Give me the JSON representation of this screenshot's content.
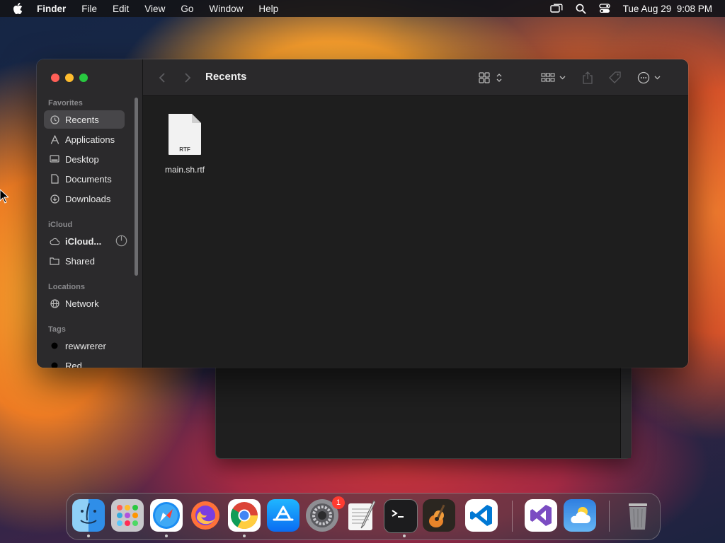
{
  "menubar": {
    "app_name": "Finder",
    "items": [
      "File",
      "Edit",
      "View",
      "Go",
      "Window",
      "Help"
    ],
    "clock": "Tue Aug 29  9:08 PM",
    "status_icons": [
      "screen-mirroring-icon",
      "spotlight-search-icon",
      "control-center-icon"
    ]
  },
  "finder": {
    "title": "Recents",
    "sidebar": {
      "favorites_label": "Favorites",
      "favorites": [
        {
          "label": "Recents",
          "icon": "clock-icon",
          "selected": true
        },
        {
          "label": "Applications",
          "icon": "applications-icon"
        },
        {
          "label": "Desktop",
          "icon": "desktop-icon"
        },
        {
          "label": "Documents",
          "icon": "document-icon"
        },
        {
          "label": "Downloads",
          "icon": "download-icon"
        }
      ],
      "icloud_label": "iCloud",
      "icloud": [
        {
          "label": "iCloud...",
          "icon": "cloud-icon"
        },
        {
          "label": "Shared",
          "icon": "shared-folder-icon"
        }
      ],
      "locations_label": "Locations",
      "locations": [
        {
          "label": "Network",
          "icon": "globe-icon"
        }
      ],
      "tags_label": "Tags",
      "tags": [
        {
          "label": "rewwrerer",
          "color": "#000000"
        },
        {
          "label": "Red",
          "color": "#000000"
        }
      ]
    },
    "files": [
      {
        "name": "main.sh.rtf",
        "type_label": "RTF"
      }
    ]
  },
  "dock": {
    "apps": [
      {
        "name": "Finder",
        "icon": "finder-icon",
        "running": true
      },
      {
        "name": "Launchpad",
        "icon": "launchpad-icon",
        "running": false
      },
      {
        "name": "Safari",
        "icon": "safari-icon",
        "running": true
      },
      {
        "name": "Firefox",
        "icon": "firefox-icon",
        "running": false
      },
      {
        "name": "Chrome",
        "icon": "chrome-icon",
        "running": true
      },
      {
        "name": "App Store",
        "icon": "app-store-icon",
        "running": false
      },
      {
        "name": "System Settings",
        "icon": "settings-icon",
        "running": false,
        "badge": "1"
      },
      {
        "name": "TextEdit",
        "icon": "textedit-icon",
        "running": false
      },
      {
        "name": "Terminal",
        "icon": "terminal-icon",
        "running": true
      },
      {
        "name": "GarageBand",
        "icon": "garageband-icon",
        "running": false
      },
      {
        "name": "Visual Studio Code",
        "icon": "vscode-icon",
        "running": false
      },
      {
        "name": "Visual Studio",
        "icon": "visual-studio-icon",
        "running": false
      },
      {
        "name": "Weather",
        "icon": "weather-icon",
        "running": false
      },
      {
        "name": "Trash",
        "icon": "trash-icon",
        "running": false
      }
    ]
  }
}
